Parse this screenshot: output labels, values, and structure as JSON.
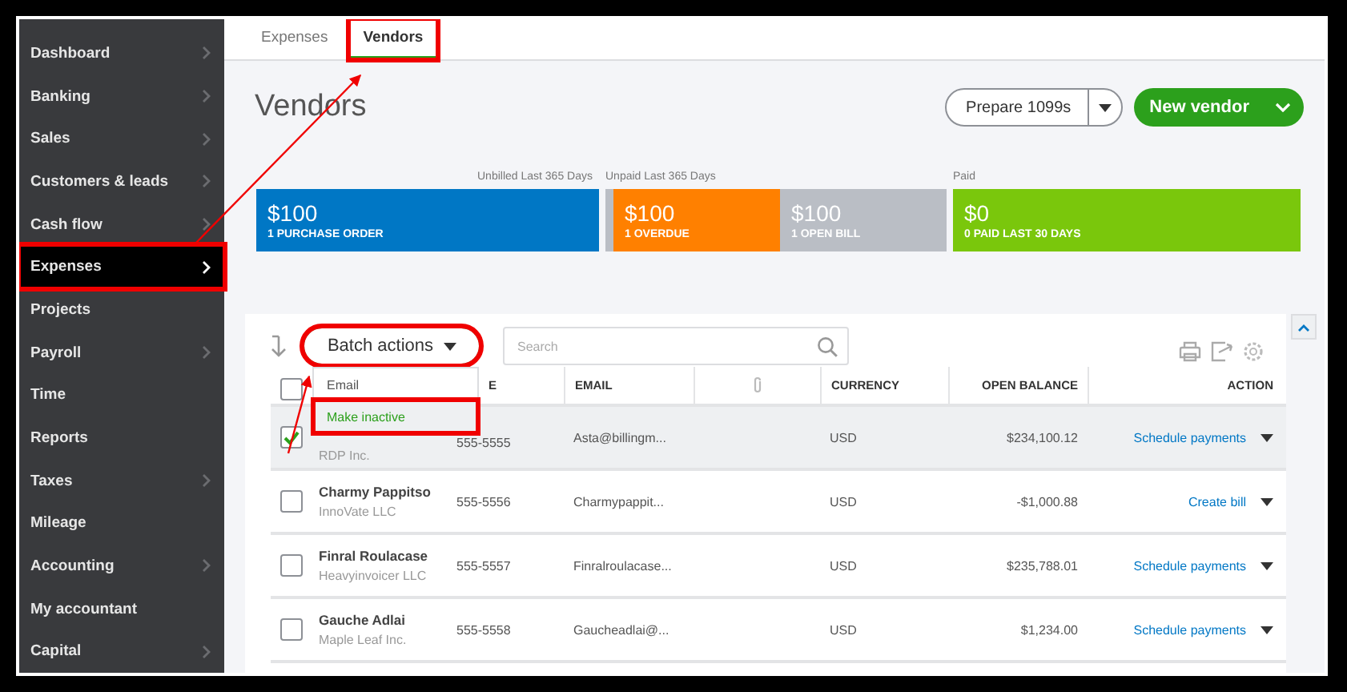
{
  "sidebar": {
    "items": [
      {
        "label": "Dashboard",
        "has_submenu": true,
        "selected": false,
        "annotated": false
      },
      {
        "label": "Banking",
        "has_submenu": true,
        "selected": false,
        "annotated": false
      },
      {
        "label": "Sales",
        "has_submenu": true,
        "selected": false,
        "annotated": false
      },
      {
        "label": "Customers & leads",
        "has_submenu": true,
        "selected": false,
        "annotated": false
      },
      {
        "label": "Cash flow",
        "has_submenu": true,
        "selected": false,
        "annotated": false
      },
      {
        "label": "Expenses",
        "has_submenu": true,
        "selected": true,
        "annotated": true
      },
      {
        "label": "Projects",
        "has_submenu": false,
        "selected": false,
        "annotated": false
      },
      {
        "label": "Payroll",
        "has_submenu": true,
        "selected": false,
        "annotated": false
      },
      {
        "label": "Time",
        "has_submenu": false,
        "selected": false,
        "annotated": false
      },
      {
        "label": "Reports",
        "has_submenu": false,
        "selected": false,
        "annotated": false
      },
      {
        "label": "Taxes",
        "has_submenu": true,
        "selected": false,
        "annotated": false
      },
      {
        "label": "Mileage",
        "has_submenu": false,
        "selected": false,
        "annotated": false
      },
      {
        "label": "Accounting",
        "has_submenu": true,
        "selected": false,
        "annotated": false
      },
      {
        "label": "My accountant",
        "has_submenu": false,
        "selected": false,
        "annotated": false
      },
      {
        "label": "Capital",
        "has_submenu": true,
        "selected": false,
        "annotated": false
      }
    ]
  },
  "tabs": [
    {
      "label": "Expenses",
      "selected": false,
      "annotated": false
    },
    {
      "label": "Vendors",
      "selected": true,
      "annotated": true
    }
  ],
  "page_title": "Vendors",
  "prepare_button": "Prepare 1099s",
  "new_vendor_button": "New vendor",
  "summary": [
    {
      "caption": "Unbilled Last 365 Days",
      "segments": [
        {
          "amount": "$100",
          "label": "1 PURCHASE ORDER",
          "color": "#0077c5"
        }
      ]
    },
    {
      "caption": "Unpaid Last 365 Days",
      "segments": [
        {
          "amount": "$100",
          "label": "1 OVERDUE",
          "color": "#ff8000"
        },
        {
          "amount": "$100",
          "label": "1 OPEN BILL",
          "color": "#babec5"
        }
      ]
    },
    {
      "caption": "Paid",
      "segments": [
        {
          "amount": "$0",
          "label": "0 PAID LAST 30 DAYS",
          "color": "#7ac70c"
        }
      ]
    }
  ],
  "batch_actions": {
    "label": "Batch actions",
    "annotated": true,
    "menu": [
      {
        "label": "Email",
        "highlighted": false,
        "annotated": false
      },
      {
        "label": "Make inactive",
        "highlighted": true,
        "annotated": true
      }
    ]
  },
  "search": {
    "placeholder": "Search"
  },
  "select_all": {
    "checked": false
  },
  "table": {
    "columns": [
      "E",
      "EMAIL",
      "CURRENCY",
      "OPEN BALANCE",
      "ACTION"
    ],
    "rows": [
      {
        "company": "RDP Inc.",
        "phone": "555-5555",
        "email": "Asta@billingm...",
        "currency": "USD",
        "balance": "$234,100.12",
        "action": "Schedule payments",
        "selected": true
      },
      {
        "name": "Charmy Pappitso",
        "company": "InnoVate LLC",
        "phone": "555-5556",
        "email": "Charmypappit...",
        "currency": "USD",
        "balance": "-$1,000.88",
        "action": "Create bill",
        "selected": false
      },
      {
        "name": "Finral Roulacase",
        "company": "Heavyinvoicer LLC",
        "phone": "555-5557",
        "email": "Finralroulacase...",
        "currency": "USD",
        "balance": "$235,788.01",
        "action": "Schedule payments",
        "selected": false
      },
      {
        "name": "Gauche Adlai",
        "company": "Maple Leaf Inc.",
        "phone": "555-5558",
        "email": "Gaucheadlai@...",
        "currency": "USD",
        "balance": "$1,234.00",
        "action": "Schedule payments",
        "selected": false
      }
    ]
  }
}
